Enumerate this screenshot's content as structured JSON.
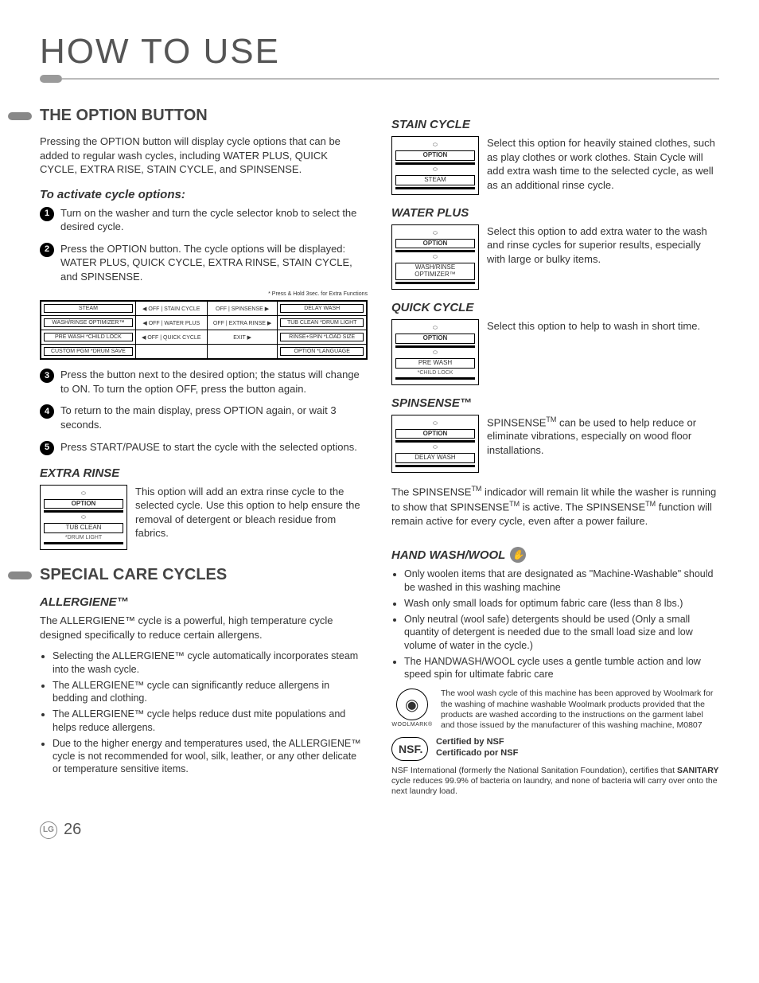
{
  "page": {
    "title": "HOW TO USE",
    "number": "26",
    "logo": "LG"
  },
  "section1": {
    "title": "THE OPTION BUTTON",
    "intro": "Pressing the OPTION button will display cycle options that can be added to regular wash cycles, including WATER PLUS, QUICK CYCLE, EXTRA RISE, STAIN CYCLE, and SPINSENSE.",
    "subhead": "To activate cycle options:",
    "steps": [
      "Turn on the washer and turn the cycle selector knob to select the desired cycle.",
      "Press the OPTION button. The cycle options will be displayed: WATER PLUS, QUICK CYCLE, EXTRA RINSE, STAIN CYCLE, and SPINSENSE.",
      "Press the button next to the desired option; the status will change to ON. To turn the option OFF, press the button again.",
      "To return to the main display, press OPTION again, or wait 3 seconds.",
      "Press START/PAUSE to start the cycle with the selected options."
    ],
    "caption": "* Press & Hold 3sec. for Extra Functions",
    "tableLeft": [
      "STEAM",
      "WASH/RINSE OPTIMIZER™",
      "PRE WASH\n*CHILD LOCK",
      "CUSTOM PGM\n*DRUM SAVE"
    ],
    "tableMid": [
      "OFF | STAIN CYCLE",
      "OFF | WATER PLUS",
      "OFF | QUICK CYCLE"
    ],
    "tableMid2": [
      "OFF | SPINSENSE",
      "OFF | EXTRA RINSE",
      "EXIT"
    ],
    "tableRight": [
      "DELAY WASH",
      "TUB CLEAN\n*DRUM LIGHT",
      "RINSE+SPIN\n*LOAD SIZE",
      "OPTION\n*LANGUAGE"
    ]
  },
  "options": {
    "extraRinse": {
      "title": "EXTRA RINSE",
      "panel": {
        "btn1": "OPTION",
        "btn2": "TUB CLEAN",
        "sub": "*DRUM LIGHT"
      },
      "text": "This option will add an extra rinse cycle to the selected cycle. Use this option to help ensure the removal of detergent or bleach residue from fabrics."
    },
    "stainCycle": {
      "title": "STAIN CYCLE",
      "panel": {
        "btn1": "OPTION",
        "btn2": "STEAM",
        "sub": ""
      },
      "text": "Select this option for heavily stained clothes, such as play clothes or work clothes. Stain Cycle will add extra wash time to the selected cycle, as well as an additional rinse cycle."
    },
    "waterPlus": {
      "title": "WATER PLUS",
      "panel": {
        "btn1": "OPTION",
        "btn2": "WASH/RINSE OPTIMIZER™",
        "sub": ""
      },
      "text": "Select this option to add extra water to the wash and rinse cycles for superior results, especially with large or bulky items."
    },
    "quickCycle": {
      "title": "QUICK CYCLE",
      "panel": {
        "btn1": "OPTION",
        "btn2": "PRE WASH",
        "sub": "*CHILD LOCK"
      },
      "text": "Select this option to help to wash in short time."
    },
    "spinsense": {
      "title": "SPINSENSE™",
      "panel": {
        "btn1": "OPTION",
        "btn2": "DELAY WASH",
        "sub": ""
      },
      "text1": "SPINSENSE",
      "text2": " can be used to help reduce or eliminate vibrations, especially on wood floor installations.",
      "text3": "The SPINSENSE",
      "text4": " indicador will remain lit while the washer is running to show that SPINSENSE",
      "text5": " is active. The SPINSENSE",
      "text6": " function will remain active for every cycle, even after a power failure."
    }
  },
  "section2": {
    "title": "SPECIAL CARE CYCLES",
    "allergiene": {
      "title": "ALLERGIENE™",
      "intro": "The ALLERGIENE™ cycle is a powerful, high temperature cycle designed specifically to reduce certain allergens.",
      "bullets": [
        "Selecting the ALLERGIENE™ cycle automatically incorporates steam into the wash cycle.",
        "The ALLERGIENE™ cycle can significantly reduce allergens in bedding and clothing.",
        "The ALLERGIENE™ cycle helps reduce dust mite populations and helps reduce allergens.",
        "Due to the higher energy and temperatures used, the ALLERGIENE™ cycle is not recommended for wool, silk, leather, or any other delicate or temperature sensitive items."
      ]
    },
    "handWash": {
      "title": "HAND WASH/WOOL",
      "bullets": [
        "Only woolen items that are designated as \"Machine-Washable\" should be washed in this washing machine",
        "Wash only small loads for optimum fabric care (less than 8 lbs.)",
        "Only neutral (wool safe) detergents should be used (Only a small quantity of detergent is needed due to the small load size and low volume of water in the cycle.)",
        "The HANDWASH/WOOL cycle uses a gentle tumble action and low speed spin for ultimate fabric care"
      ]
    },
    "woolmark": {
      "label": "WOOLMARK",
      "reg": "®",
      "text": "The wool wash cycle of this machine has been approved by Woolmark for the washing of machine washable Woolmark products provided that the products are washed according to the instructions on the garment label and those issued by the manufacturer of this washing machine, M0807"
    },
    "nsf": {
      "badge": "NSF.",
      "line1": "Certified by NSF",
      "line2": "Certificado por NSF",
      "text1": "NSF International (formerly the National Sanitation Foundation), certifies that ",
      "bold": "SANITARY",
      "text2": " cycle reduces 99.9% of bacteria on laundry, and none of bacteria will carry over onto the next laundry load."
    }
  }
}
